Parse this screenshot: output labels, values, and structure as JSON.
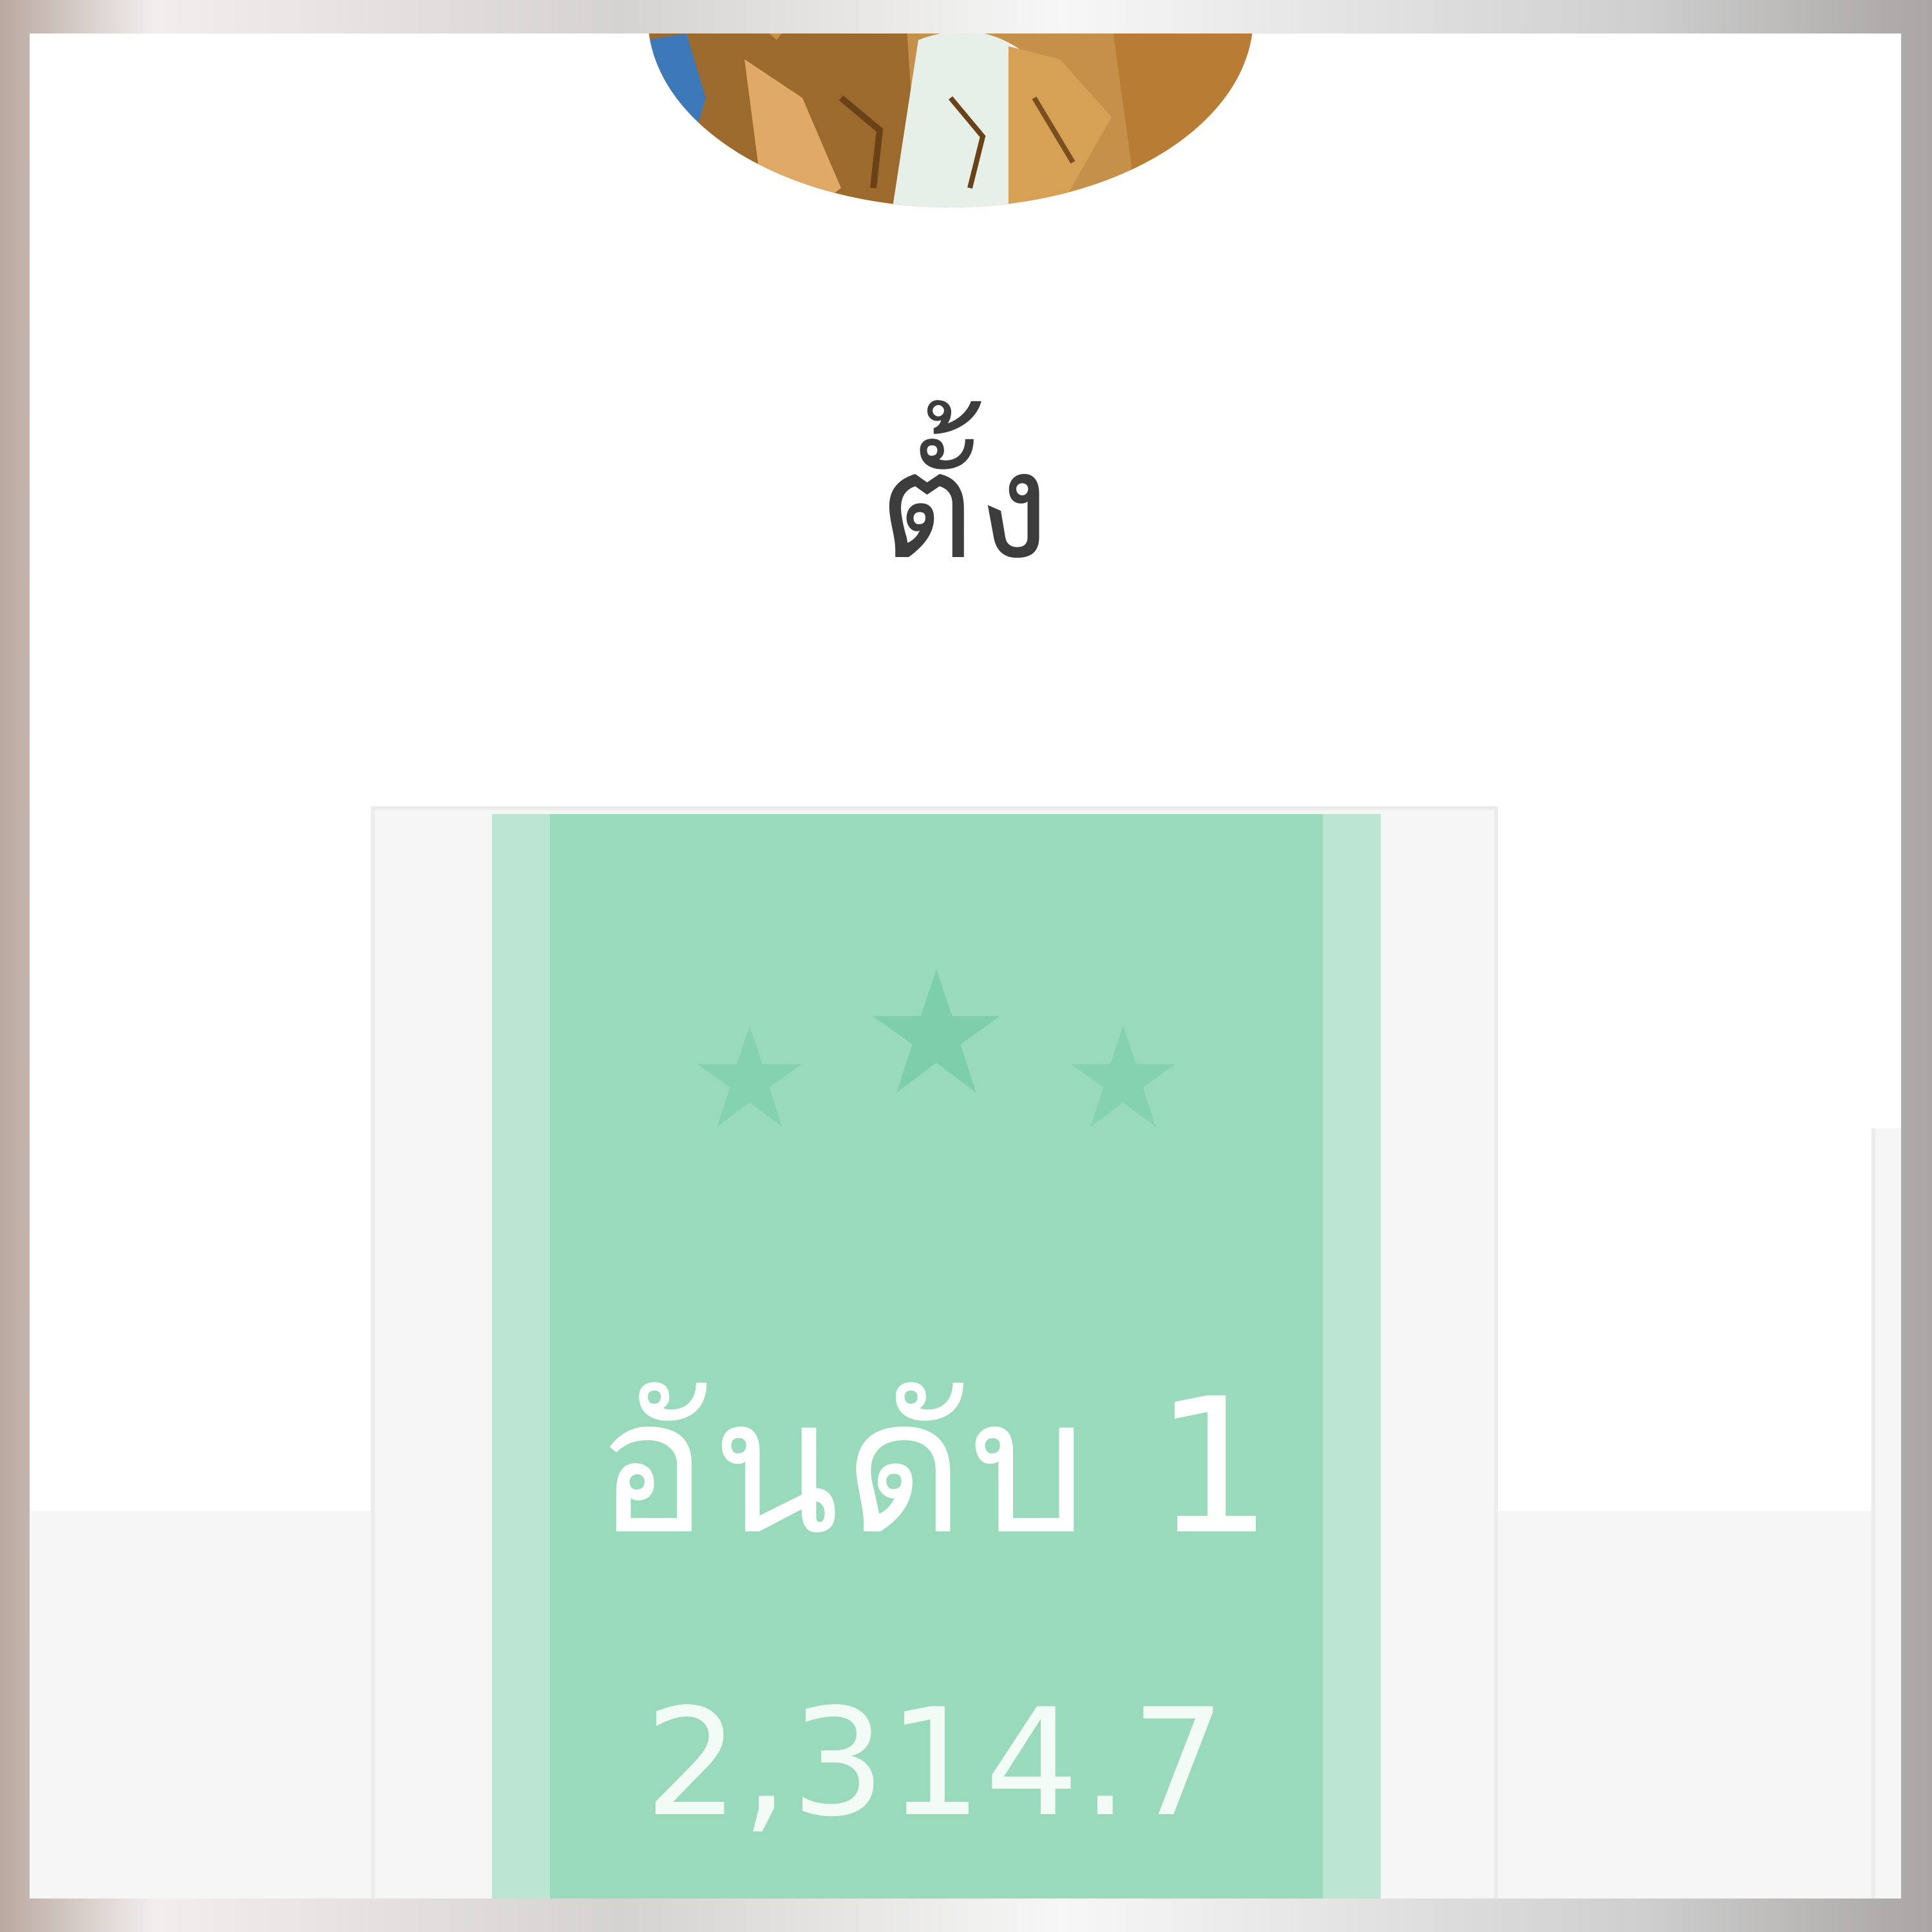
{
  "profile": {
    "username": "ตั้ง",
    "avatar_icon": "user-avatar-image"
  },
  "rank": {
    "label": "อันดับ 1",
    "score": "2,314.7",
    "stars": 3,
    "colors": {
      "column_outer": "#bce5d4",
      "column_inner": "#99d9bc",
      "star": "#7fd0ad",
      "text": "#ffffff"
    }
  }
}
